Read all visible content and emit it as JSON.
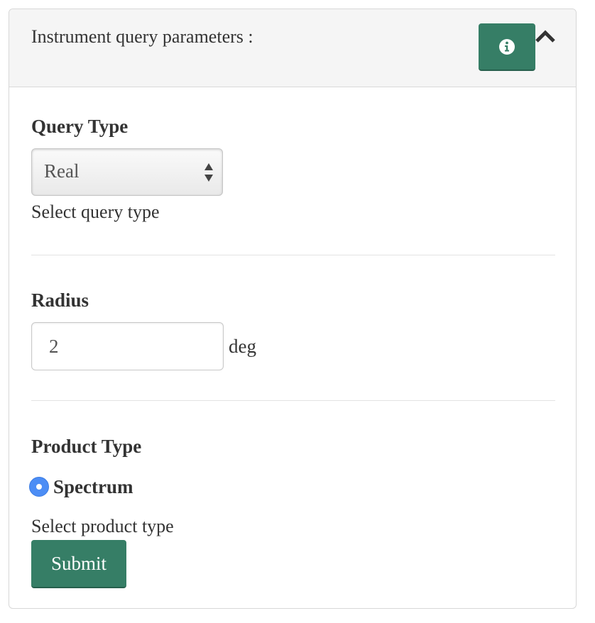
{
  "panel": {
    "title": "Instrument query parameters :",
    "info_icon": "info-circle-icon",
    "collapse_icon": "chevron-up-icon",
    "accent_color": "#367e66"
  },
  "query_type": {
    "label": "Query Type",
    "selected": "Real",
    "help": "Select query type",
    "arrows_icon": "select-updown-arrows-icon"
  },
  "radius": {
    "label": "Radius",
    "value": "2",
    "unit": "deg"
  },
  "product_type": {
    "label": "Product Type",
    "option": "Spectrum",
    "option_selected": true,
    "help": "Select product type",
    "radio_color": "#4c8df5"
  },
  "actions": {
    "submit_label": "Submit"
  }
}
